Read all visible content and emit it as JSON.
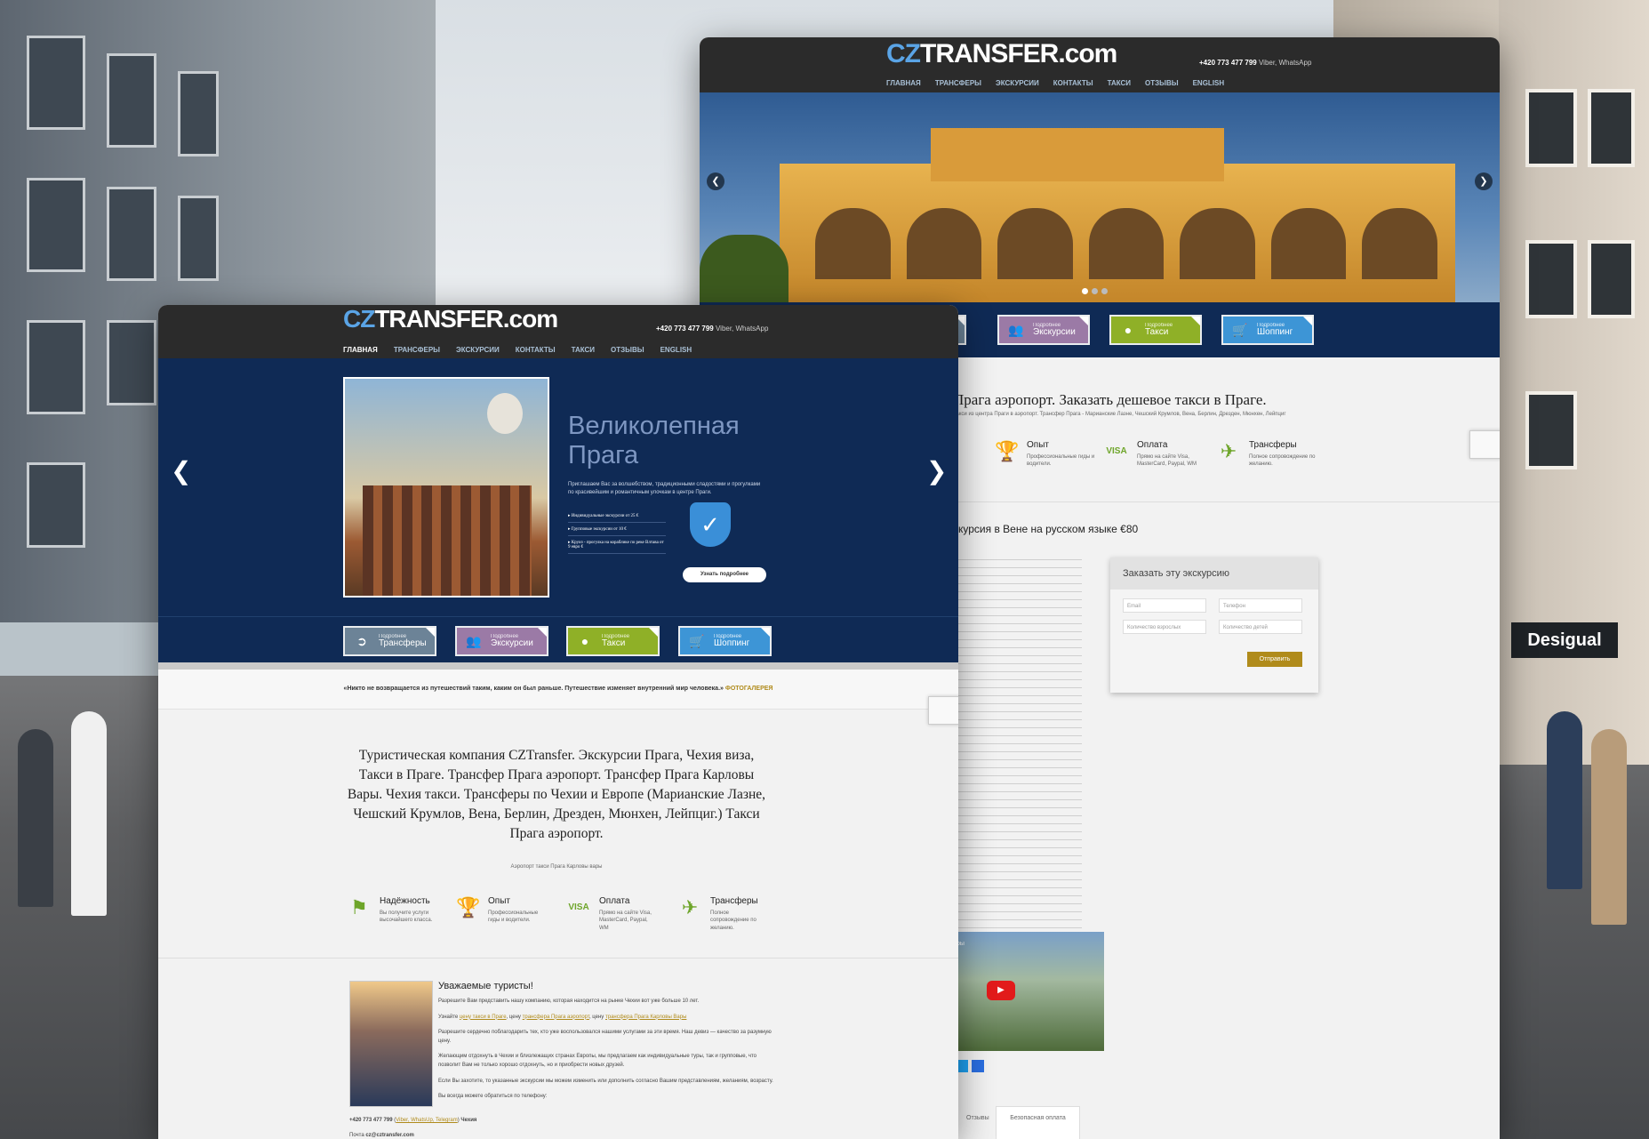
{
  "back_site": {
    "logo_cz": "CZ",
    "logo_rest": "TRANSFER.com",
    "phone": "+420 773 477 799",
    "phone_suffix": "Viber, WhatsApp",
    "nav": [
      "ГЛАВНАЯ",
      "ТРАНСФЕРЫ",
      "ЭКСКУРСИИ",
      "КОНТАКТЫ",
      "ТАКСИ",
      "ОТЗЫВЫ",
      "ENGLISH"
    ],
    "tiles": [
      {
        "small": "Подробнее",
        "big": "Экскурсии",
        "color": "#9b7aa6"
      },
      {
        "small": "Подробнее",
        "big": "Такси",
        "color": "#8fb027"
      },
      {
        "small": "Подробнее",
        "big": "Шоппинг",
        "color": "#3d95d6"
      }
    ],
    "heading": "Прага аэропорт. Заказать дешевое такси в Праге.",
    "subheading": "Такси из центра Праги в аэропорт. Трансфер Прага - Марианские Лазне, Чешский Крумлов, Вена, Берлин, Дрезден, Мюнхен, Лейпциг",
    "features": [
      {
        "title": "Опыт",
        "desc": "Профессиональные гиды и водители."
      },
      {
        "title": "Оплата",
        "desc": "Прямо на сайте Visa, MasterCard, Paypal, WM"
      },
      {
        "title": "Трансферы",
        "desc": "Полное сопровождение по желанию."
      }
    ],
    "tour_title": "скурсия в Вене на русском языке €80",
    "form": {
      "title": "Заказать эту экскурсию",
      "email": "Email",
      "phone": "Телефон",
      "adults": "Количество взрослых",
      "children": "Количество детей",
      "submit": "Отправить"
    },
    "tabs": [
      "Отзывы",
      "Безопасная оплата"
    ],
    "video_label": "ры"
  },
  "front_site": {
    "logo_cz": "CZ",
    "logo_rest": "TRANSFER.com",
    "phone": "+420 773 477 799",
    "phone_suffix": "Viber, WhatsApp",
    "nav": [
      "ГЛАВНАЯ",
      "ТРАНСФЕРЫ",
      "ЭКСКУРСИИ",
      "КОНТАКТЫ",
      "ТАКСИ",
      "ОТЗЫВЫ",
      "ENGLISH"
    ],
    "hero_title_1": "Великолепная",
    "hero_title_2": "Прага",
    "hero_text": "Приглашаем Вас за волшебством, традиционными сладостями и прогулками по красивейшим и романтичным улочкам в центре Праги.",
    "hero_list": [
      "Индивидуальные экскурсии от 25 €",
      "Групповые экскурсии от 10 €",
      "Круиз - прогулка на кораблике по реке Влтава от 9 евро €"
    ],
    "hero_button": "Узнать подробнее",
    "tiles": [
      {
        "small": "Подробнее",
        "big": "Трансферы",
        "color": "#6c8397"
      },
      {
        "small": "Подробнее",
        "big": "Экскурсии",
        "color": "#9b7aa6"
      },
      {
        "small": "Подробнее",
        "big": "Такси",
        "color": "#8fb027"
      },
      {
        "small": "Подробнее",
        "big": "Шоппинг",
        "color": "#3d95d6"
      }
    ],
    "quote": "«Никто не возвращается из путешествий таким, каким он был раньше. Путешествие изменяет внутренний мир человека.»",
    "quote_link": "ФОТОГАЛЕРЕЯ",
    "main_heading": "Туристическая компания CZTransfer. Экскурсии Прага, Чехия виза, Такси в Праге. Трансфер Прага аэропорт. Трансфер Прага Карловы Вары. Чехия такси. Трансферы по Чехии и Европе (Марианские Лазне, Чешский Крумлов, Вена, Берлин, Дрезден, Мюнхен, Лейпциг.) Такси Прага аэропорт.",
    "main_sub": "Аэропорт такси Прага Карловы вары",
    "features": [
      {
        "title": "Надёжность",
        "desc": "Вы получите услуги высочайшего класса."
      },
      {
        "title": "Опыт",
        "desc": "Профессиональные гиды и водители."
      },
      {
        "title": "Оплата",
        "desc": "Прямо на сайте Visa, MasterCard, Paypal, WM"
      },
      {
        "title": "Трансферы",
        "desc": "Полное сопровождение по желанию."
      }
    ],
    "welcome_title": "Уважаемые туристы!",
    "welcome_p1": "Разрешите Вам представить нашу компанию, которая находится на рынке Чехии вот уже больше 10 лет.",
    "welcome_p2_pre": "Узнайте",
    "welcome_link1": "цену такси в Праге",
    "welcome_p2_mid": ", цену",
    "welcome_link2": "трансфера Прага аэропорт",
    "welcome_p2_mid2": ", цену",
    "welcome_link3": "трансфера Прага Карловы Вары",
    "welcome_p3": "Разрешите сердечно поблагодарить тех, кто уже воспользовался нашими услугами за эти время. Наш девиз — качество за разумную цену.",
    "welcome_p4": "Желающим отдохнуть в Чехии и близлежащих странах Европы, мы предлагаем как индивидуальные туры, так и групповые, что позволит Вам не только хорошо отдохнуть, но и приобрести новых друзей.",
    "welcome_p5": "Если Вы захотите, то указанные экскурсии мы можем изменить или дополнить согласно Вашим представлениям, желаниям, возрасту.",
    "welcome_p6": "Вы всегда можете обратиться по телефону:",
    "welcome_phone": "+420 773 477 799",
    "welcome_phone_apps": "Viber, WhatsUp, Telegram",
    "welcome_phone_tail": "Чехия",
    "welcome_mail_label": "Почта",
    "welcome_mail": "cz@cztransfer.com"
  },
  "background": {
    "shop_sign": "Desigual"
  },
  "colors": {
    "header_bg": "#2b2b2b",
    "hero_bg": "#0f2a55",
    "accent_gold": "#b08b1b",
    "accent_green": "#6ea52a"
  }
}
